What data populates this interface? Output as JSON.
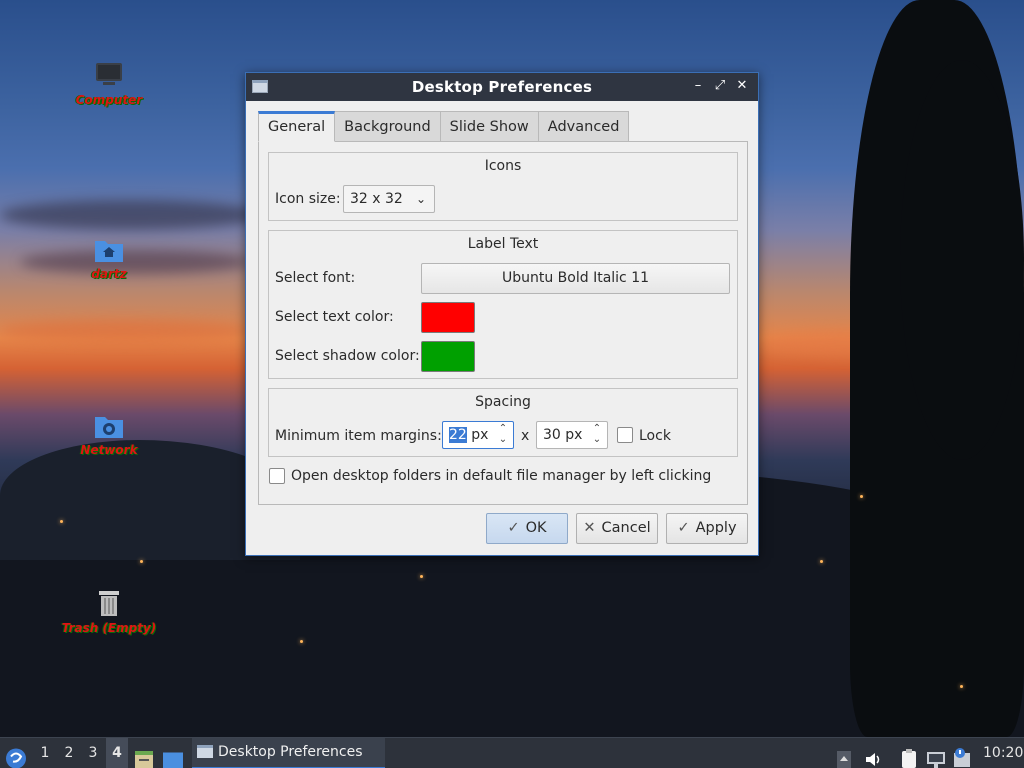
{
  "desktop": {
    "icons": [
      {
        "label": "Computer",
        "icon": "computer-icon"
      },
      {
        "label": "dartz",
        "icon": "home-folder-icon"
      },
      {
        "label": "Network",
        "icon": "network-folder-icon"
      },
      {
        "label": "Trash (Empty)",
        "icon": "trash-icon"
      }
    ],
    "label_color": "#e01414"
  },
  "dialog": {
    "title": "Desktop Preferences",
    "tabs": [
      {
        "label": "General",
        "active": true
      },
      {
        "label": "Background",
        "active": false
      },
      {
        "label": "Slide Show",
        "active": false
      },
      {
        "label": "Advanced",
        "active": false
      }
    ],
    "icons_group": {
      "title": "Icons",
      "icon_size_label": "Icon size:",
      "icon_size_value": "32 x 32"
    },
    "label_text_group": {
      "title": "Label Text",
      "select_font_label": "Select font:",
      "font_value": "Ubuntu Bold Italic 11",
      "text_color_label": "Select text color:",
      "text_color": "#ff0000",
      "shadow_color_label": "Select shadow color:",
      "shadow_color": "#00a000"
    },
    "spacing_group": {
      "title": "Spacing",
      "margins_label": "Minimum item margins:",
      "margin_x_value": "22",
      "margin_x_unit": "px",
      "separator": "x",
      "margin_y_value": "30 px",
      "lock_label": "Lock",
      "lock_checked": false
    },
    "open_folders_label": "Open desktop folders in default file manager by left clicking",
    "open_folders_checked": false,
    "buttons": {
      "ok": "OK",
      "cancel": "Cancel",
      "apply": "Apply"
    }
  },
  "taskbar": {
    "workspaces": [
      "1",
      "2",
      "3",
      "4"
    ],
    "active_workspace": "4",
    "task_title": "Desktop Preferences",
    "clock": "10:20"
  }
}
